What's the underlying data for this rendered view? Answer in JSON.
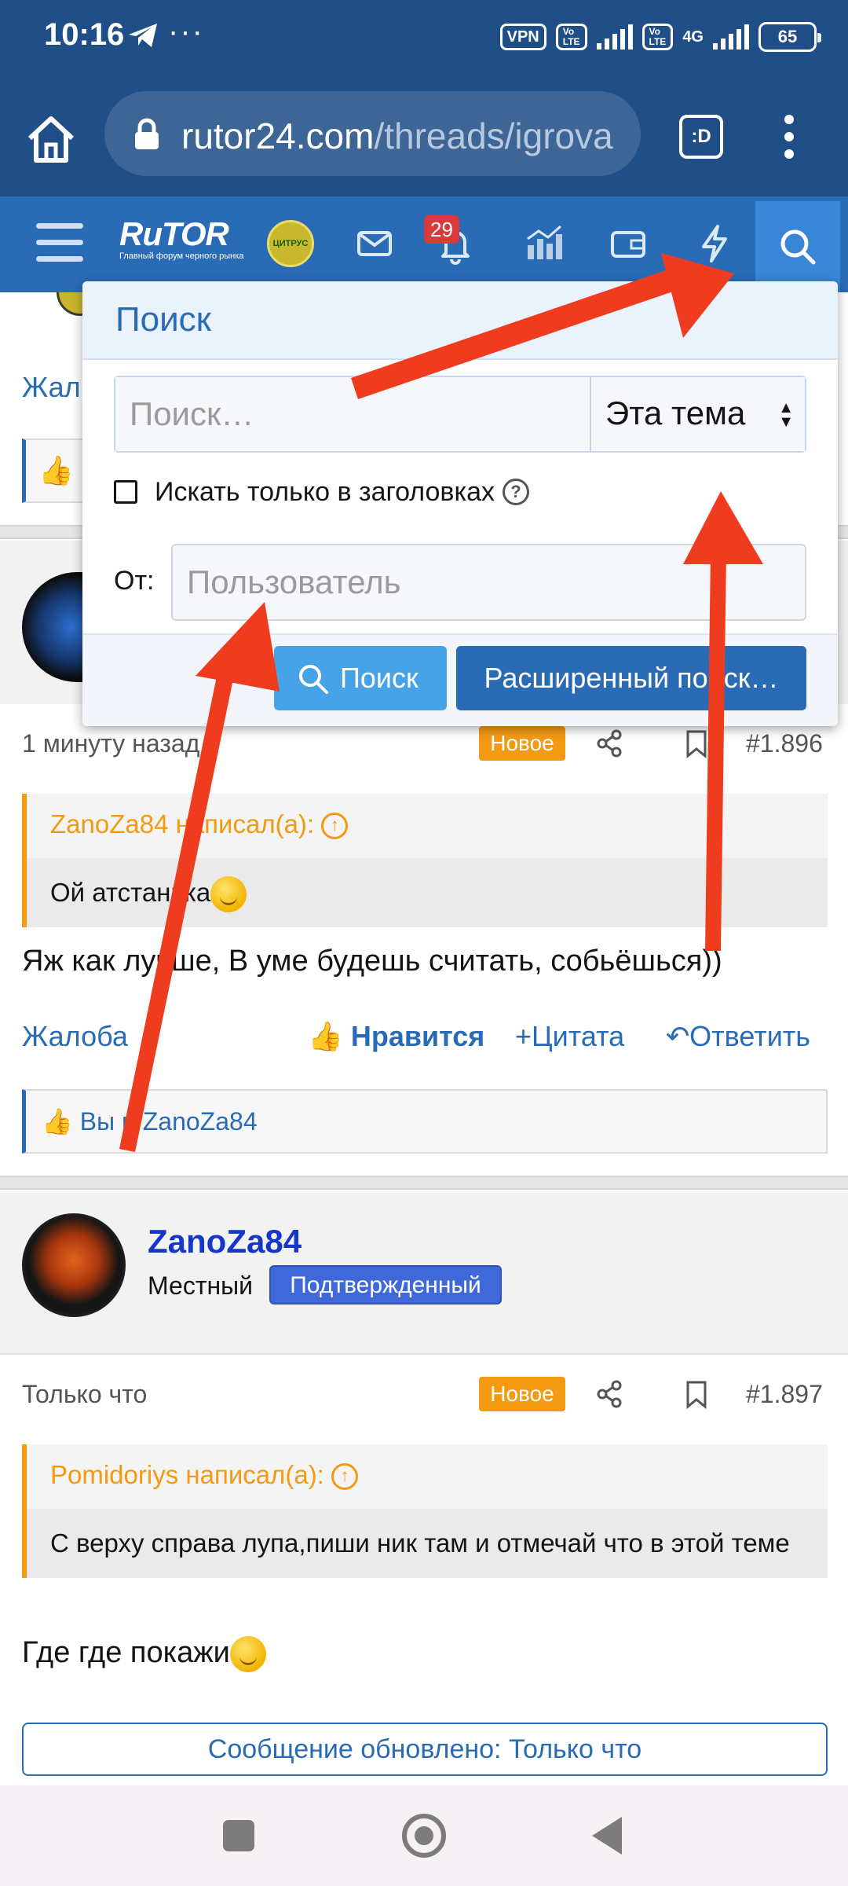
{
  "status_bar": {
    "time": "10:16",
    "dots": "···",
    "vpn": "VPN",
    "net_label": "4G",
    "battery": "65"
  },
  "browser": {
    "url_host": "rutor24.com",
    "url_path": "/threads/igrova",
    "tabs_icon_text": ":D"
  },
  "site_nav": {
    "logo_text": "RuTOR",
    "logo_tagline": "Главный форум черного рынка",
    "partner_logo": "ЦИТРУС",
    "notifications_count": "29",
    "accent_color": "#2a6bb5"
  },
  "search_popup": {
    "title": "Поиск",
    "query_placeholder": "Поиск…",
    "scope_value": "Эта тема",
    "titles_only_label": "Искать только в заголовках",
    "help_glyph": "?",
    "from_label": "От:",
    "user_placeholder": "Пользователь",
    "search_button": "Поиск",
    "advanced_button": "Расширенный поиск…"
  },
  "background": {
    "top_action_partial": "Жал"
  },
  "post1": {
    "time": "1 минуту назад",
    "new_badge": "Новое",
    "number": "#1.896",
    "quote_author": "ZanoZa84 написал(а):",
    "quote_text": "Ой атстанька",
    "text": "Яж как лучше, В уме будешь считать, собьёшься))",
    "actions": {
      "report": "Жалоба",
      "like": "Нравится",
      "quote": "Цитата",
      "reply": "Ответить"
    },
    "likes": "Вы и ZanoZa84"
  },
  "post2": {
    "username": "ZanoZa84",
    "rank": "Местный",
    "verified_badge": "Подтвержденный",
    "time": "Только что",
    "new_badge": "Новое",
    "number": "#1.897",
    "quote_author": "Pomidoriys написал(а):",
    "quote_text": "С верху справа лупа,пиши ник там и отмечай что в этой теме",
    "text": "Где где покажи"
  },
  "updated_notice": "Сообщение обновлено: Только что"
}
